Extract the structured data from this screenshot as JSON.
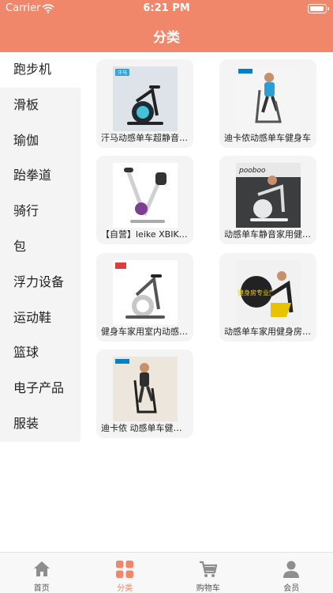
{
  "status_bar": {
    "carrier": "Carrier",
    "time": "6:21 PM",
    "battery_level": 0.9
  },
  "nav": {
    "title": "分类"
  },
  "sidebar": {
    "items": [
      {
        "label": "跑步机",
        "active": true
      },
      {
        "label": "滑板",
        "active": false
      },
      {
        "label": "瑜伽",
        "active": false
      },
      {
        "label": "跆拳道",
        "active": false
      },
      {
        "label": "骑行",
        "active": false
      },
      {
        "label": "包",
        "active": false
      },
      {
        "label": "浮力设备",
        "active": false
      },
      {
        "label": "运动鞋",
        "active": false
      },
      {
        "label": "篮球",
        "active": false
      },
      {
        "label": "电子产品",
        "active": false
      },
      {
        "label": "服装",
        "active": false
      }
    ]
  },
  "products": [
    {
      "name": "汗马动感单车超静音家用",
      "image_badge": "汗马"
    },
    {
      "name": "迪卡侬动感单车健身车",
      "image_badge": "DECATHLON"
    },
    {
      "name": "【自营】leike XBIKE健身车",
      "image_badge": ""
    },
    {
      "name": "动感单车静音家用健身车",
      "image_badge": "pooboo"
    },
    {
      "name": "健身车家用室内动感单车",
      "image_badge": ""
    },
    {
      "name": "动感单车家用健身房专业款",
      "image_badge": "健身房专业款"
    },
    {
      "name": "迪卡侬 动感单车健身车",
      "image_badge": "DECATHLON"
    }
  ],
  "tab_bar": {
    "tabs": [
      {
        "label": "首页",
        "icon": "home-icon",
        "active": false
      },
      {
        "label": "分类",
        "icon": "category-grid-icon",
        "active": true
      },
      {
        "label": "购物车",
        "icon": "cart-icon",
        "active": false
      },
      {
        "label": "会员",
        "icon": "member-icon",
        "active": false
      }
    ]
  },
  "colors": {
    "accent": "#F0876A",
    "sidebar_bg": "#f4f4f4",
    "card_bg": "#f4f4f4",
    "tab_inactive": "#8e8e8e"
  }
}
